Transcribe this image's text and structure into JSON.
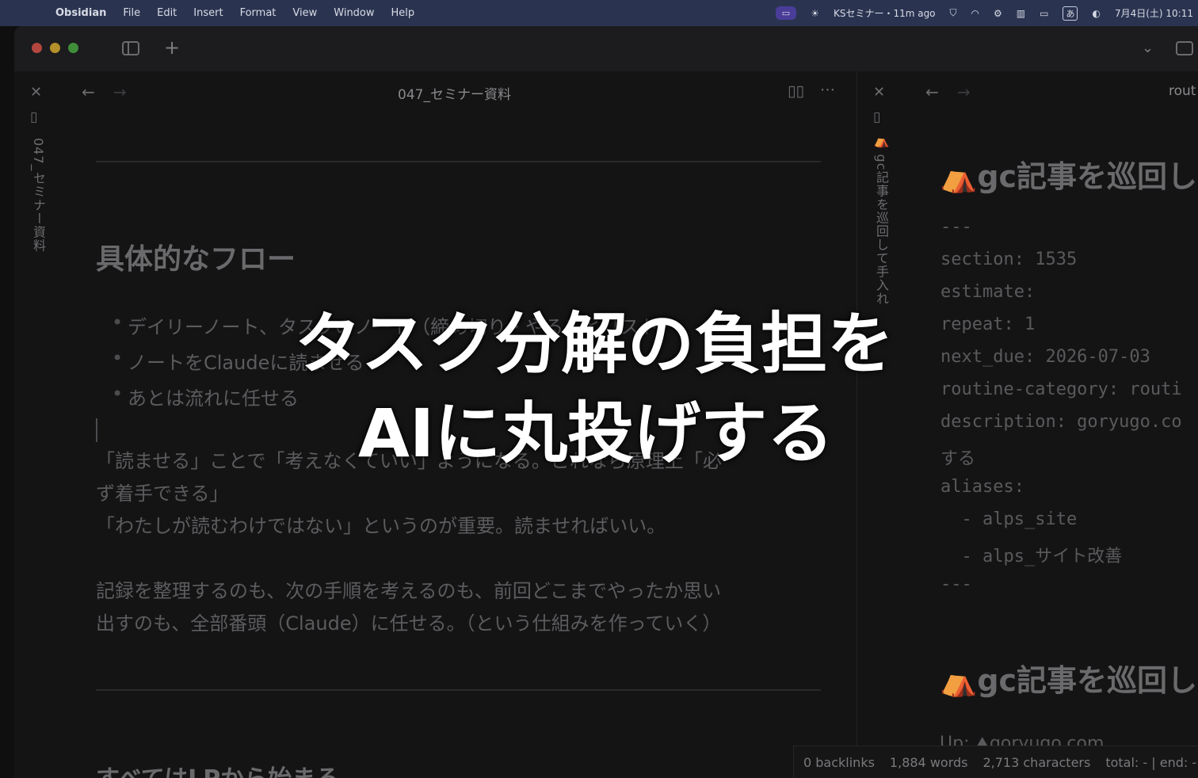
{
  "menubar": {
    "apple_icon": "apple-icon",
    "app_name": "Obsidian",
    "items": [
      "File",
      "Edit",
      "Insert",
      "Format",
      "View",
      "Window",
      "Help"
    ],
    "status": {
      "notification": "KSセミナー・11m ago",
      "input_source": "あ",
      "datetime": "7月4日(土) 10:11"
    }
  },
  "left_pane": {
    "vertical_title": "047_セミナー資料",
    "header_title": "047_セミナー資料",
    "heading": "具体的なフロー",
    "bullets": [
      "デイリーノート、タスクのノート（締め切り・やることリスト）",
      "ノートをClaudeに読ませる",
      "あとは流れに任せる"
    ],
    "para1_line1": "「読ませる」ことで「考えなくていい」ようになる。これなら原理上「必",
    "para1_line2": "ず着手できる」",
    "para1_line3": "「わたしが読むわけではない」というのが重要。読ませればいい。",
    "para2_line1": "記録を整理するのも、次の手順を考えるのも、前回どこまでやったか思い",
    "para2_line2": "出すのも、全部番頭（Claude）に任せる。（という仕組みを作っていく）",
    "next_heading": "すべてはLPから始まる"
  },
  "right_pane": {
    "vertical_title": "⛺gc記事を巡回して手入れ",
    "header_title": "rout",
    "heading": "⛺gc記事を巡回し",
    "frontmatter": [
      "---",
      "section: 1535",
      "estimate:",
      "repeat: 1",
      "next_due: 2026-07-03",
      "routine-category: routi",
      "description: goryugo.co",
      "する",
      "aliases:",
      "  - alps_site",
      "  - alps_サイト改善",
      "---"
    ],
    "heading2": "⛺gc記事を巡回し",
    "up_link": "Up: ⛰goryugo.com"
  },
  "statusbar": {
    "backlinks": "0 backlinks",
    "words": "1,884 words",
    "characters": "2,713 characters",
    "timer": "total: - | end: -"
  },
  "caption": {
    "line1": "タスク分解の負担を",
    "line2": "AIに丸投げする"
  }
}
